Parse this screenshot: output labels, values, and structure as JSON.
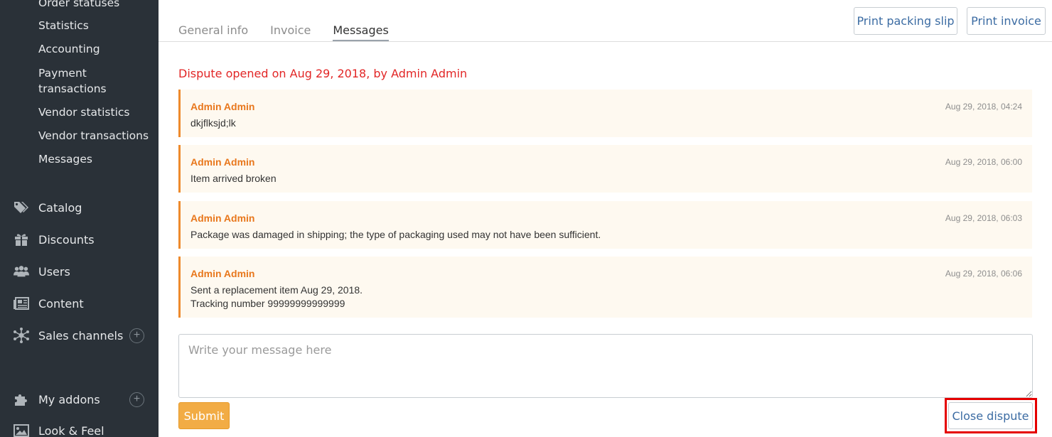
{
  "sidebar": {
    "sub_items": [
      "Order statuses",
      "Statistics",
      "Accounting",
      "Payment transactions",
      "Vendor statistics",
      "Vendor transactions",
      "Messages"
    ],
    "main_items": [
      {
        "label": "Catalog",
        "icon": "tag-icon"
      },
      {
        "label": "Discounts",
        "icon": "gift-icon"
      },
      {
        "label": "Users",
        "icon": "users-icon"
      },
      {
        "label": "Content",
        "icon": "newspaper-icon"
      },
      {
        "label": "Sales channels",
        "icon": "network-icon",
        "plus": "+"
      },
      {
        "label": "My addons",
        "icon": "puzzle-icon",
        "plus": "+"
      },
      {
        "label": "Look & Feel",
        "icon": "image-icon"
      }
    ]
  },
  "tabs": [
    "General info",
    "Invoice",
    "Messages"
  ],
  "active_tab": "Messages",
  "actions": {
    "print_packing_slip": "Print packing slip",
    "print_invoice": "Print invoice"
  },
  "dispute_banner": "Dispute opened on Aug 29, 2018, by Admin Admin",
  "messages": [
    {
      "author": "Admin Admin",
      "time": "Aug 29, 2018, 04:24",
      "text": "dkjflksjd;lk"
    },
    {
      "author": "Admin Admin",
      "time": "Aug 29, 2018, 06:00",
      "text": "Item arrived broken"
    },
    {
      "author": "Admin Admin",
      "time": "Aug 29, 2018, 06:03",
      "text": "Package was damaged in shipping; the type of packaging used may not have been sufficient."
    },
    {
      "author": "Admin Admin",
      "time": "Aug 29, 2018, 06:06",
      "text": "Sent a replacement item Aug 29, 2018.\nTracking number 99999999999999"
    }
  ],
  "composer": {
    "placeholder": "Write your message here",
    "value": "",
    "submit_label": "Submit",
    "close_dispute_label": "Close dispute"
  },
  "colors": {
    "sidebar_bg": "#2a3138",
    "accent_orange": "#ee8a2c",
    "dispute_red": "#e22626",
    "highlight_red": "#e50000",
    "link_blue": "#3c6ca3",
    "submit_bg": "#f2ac45"
  }
}
